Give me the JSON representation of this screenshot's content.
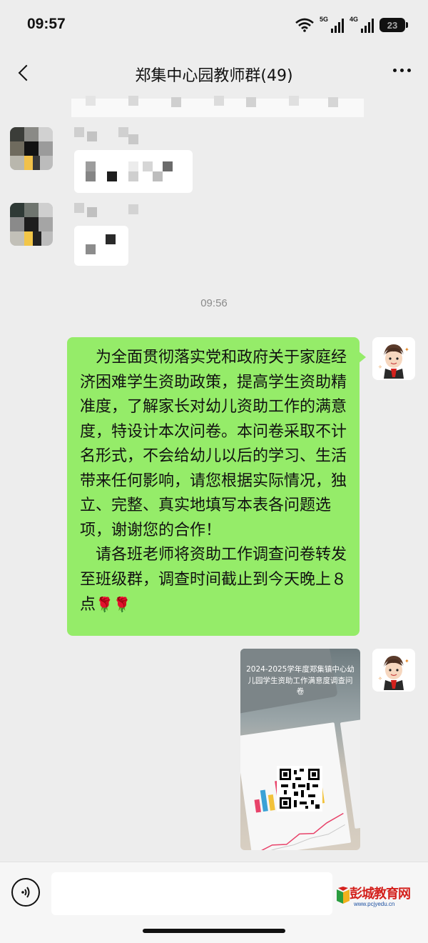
{
  "status_bar": {
    "time": "09:57",
    "network_1": "5G",
    "network_2": "4G",
    "battery": "23",
    "icons": [
      "wifi-icon",
      "signal-5g-icon",
      "signal-4g-icon",
      "battery-icon"
    ]
  },
  "nav": {
    "title": "郑集中心园教师群(49)",
    "back_icon": "chevron-left-icon",
    "more_icon": "more-dots-icon"
  },
  "chat": {
    "time_separator": "09:56",
    "message_paragraph_1": "为全面贯彻落实党和政府关于家庭经济困难学生资助政策，提高学生资助精准度，了解家长对幼儿资助工作的满意度，特设计本次问卷。本问卷采取不计名形式，不会给幼儿以后的学习、生活带来任何影响，请您根据实际情况，独立、完整、真实地填写本表各问题选项，谢谢您的合作！",
    "message_paragraph_2": "请各班老师将资助工作调查问卷转发至班级群，调查时间截止到今天晚上８点",
    "message_emoji": "🌹🌹",
    "image_caption": "2024-2025学年度郑集镇中心幼儿园学生资助工作满意度调查问卷"
  },
  "input_bar": {
    "voice_icon": "voice-icon",
    "text_value": "",
    "watermark_text": "彭城教育网",
    "watermark_url": "www.pcjyedu.cn"
  },
  "colors": {
    "background": "#ededed",
    "bubble_green": "#95ec69",
    "time_gray": "#8a8a8a"
  }
}
